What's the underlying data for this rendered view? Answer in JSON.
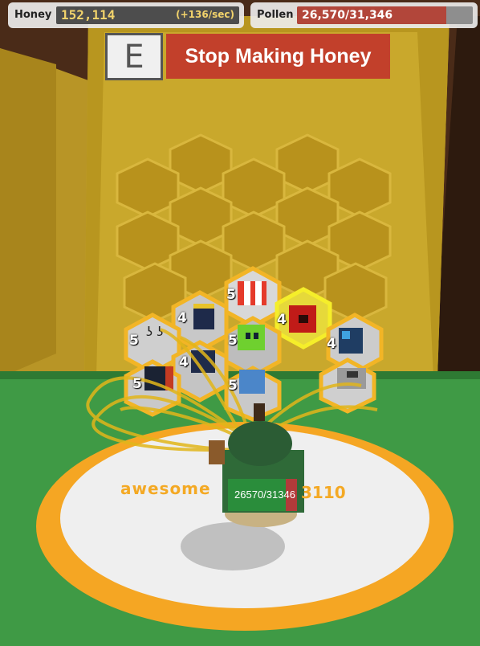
{
  "hud": {
    "honey_label": "Honey",
    "honey_amount": "152,114",
    "honey_rate": "(+136/sec)",
    "pollen_label": "Pollen",
    "pollen_text": "26,570/31,346",
    "pollen_fill_fraction": 0.8476
  },
  "prompt": {
    "key": "E",
    "action": "Stop Making Honey"
  },
  "player": {
    "name_visible": "awesome",
    "name_suffix": "3110",
    "bag_meter": "26570/31346"
  },
  "hive": {
    "bee_levels": [
      "5",
      "4",
      "4",
      "5",
      "5",
      "4",
      "4",
      "5",
      "5"
    ]
  },
  "colors": {
    "hive_wall": "#c9a82c",
    "hive_cell": "#b8921c",
    "cell_border": "#e9c64a",
    "ground": "#3f9a45",
    "platform": "#f5a623",
    "platform_inner": "#efefef",
    "action_red": "#c2402b"
  }
}
